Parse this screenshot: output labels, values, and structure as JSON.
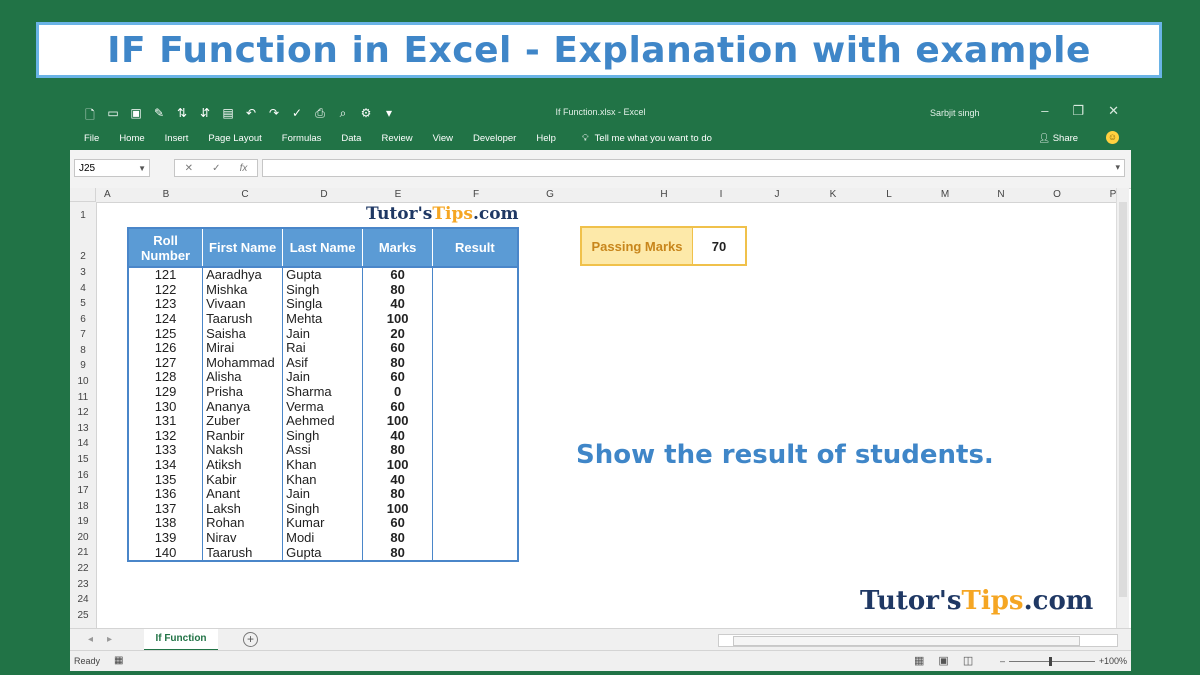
{
  "banner": {
    "title": "IF Function in Excel -  Explanation with example"
  },
  "window": {
    "doc_title": "If Function.xlsx  -  Excel",
    "user": "Sarbjit singh",
    "menu": [
      "File",
      "Home",
      "Insert",
      "Page Layout",
      "Formulas",
      "Data",
      "Review",
      "View",
      "Developer",
      "Help"
    ],
    "tell_me": "Tell me what you want to do",
    "share": "Share"
  },
  "formula_bar": {
    "name_box": "J25",
    "fx": "fx",
    "value": ""
  },
  "columns": [
    "A",
    "B",
    "C",
    "D",
    "E",
    "F",
    "G",
    "H",
    "I",
    "J",
    "K",
    "L",
    "M",
    "N",
    "O",
    "P"
  ],
  "rows": [
    "1",
    "2",
    "3",
    "4",
    "5",
    "6",
    "7",
    "8",
    "9",
    "10",
    "11",
    "12",
    "13",
    "14",
    "15",
    "16",
    "17",
    "18",
    "19",
    "20",
    "21",
    "22",
    "23",
    "24",
    "25"
  ],
  "brand": {
    "prefix": "Tutor's",
    "tips": "Tips",
    "suffix": ".com"
  },
  "table": {
    "headers": [
      "Roll Number",
      "First Name",
      "Last Name",
      "Marks",
      "Result"
    ],
    "rows": [
      [
        "121",
        "Aaradhya",
        "Gupta",
        "60",
        ""
      ],
      [
        "122",
        "Mishka",
        "Singh",
        "80",
        ""
      ],
      [
        "123",
        "Vivaan",
        "Singla",
        "40",
        ""
      ],
      [
        "124",
        "Taarush",
        "Mehta",
        "100",
        ""
      ],
      [
        "125",
        "Saisha",
        "Jain",
        "20",
        ""
      ],
      [
        "126",
        "Mirai",
        "Rai",
        "60",
        ""
      ],
      [
        "127",
        "Mohammad",
        "Asif",
        "80",
        ""
      ],
      [
        "128",
        "Alisha",
        "Jain",
        "60",
        ""
      ],
      [
        "129",
        "Prisha",
        "Sharma",
        "0",
        ""
      ],
      [
        "130",
        "Ananya",
        "Verma",
        "60",
        ""
      ],
      [
        "131",
        "Zuber",
        "Aehmed",
        "100",
        ""
      ],
      [
        "132",
        "Ranbir",
        "Singh",
        "40",
        ""
      ],
      [
        "133",
        "Naksh",
        "Assi",
        "80",
        ""
      ],
      [
        "134",
        "Atiksh",
        "Khan",
        "100",
        ""
      ],
      [
        "135",
        "Kabir",
        "Khan",
        "40",
        ""
      ],
      [
        "136",
        "Anant",
        "Jain",
        "80",
        ""
      ],
      [
        "137",
        "Laksh",
        "Singh",
        "100",
        ""
      ],
      [
        "138",
        "Rohan",
        "Kumar",
        "60",
        ""
      ],
      [
        "139",
        "Nirav",
        "Modi",
        "80",
        ""
      ],
      [
        "140",
        "Taarush",
        "Gupta",
        "80",
        ""
      ]
    ]
  },
  "passing": {
    "label": "Passing Marks",
    "value": "70"
  },
  "note": "Show the result of students.",
  "sheet_tab": "If Function",
  "status": {
    "ready": "Ready",
    "zoom": "100%"
  },
  "colors": {
    "excel_green": "#217346",
    "header_blue": "#5b9bd5",
    "banner_text": "#3f86c8",
    "passing_fill": "#fde9a9"
  }
}
